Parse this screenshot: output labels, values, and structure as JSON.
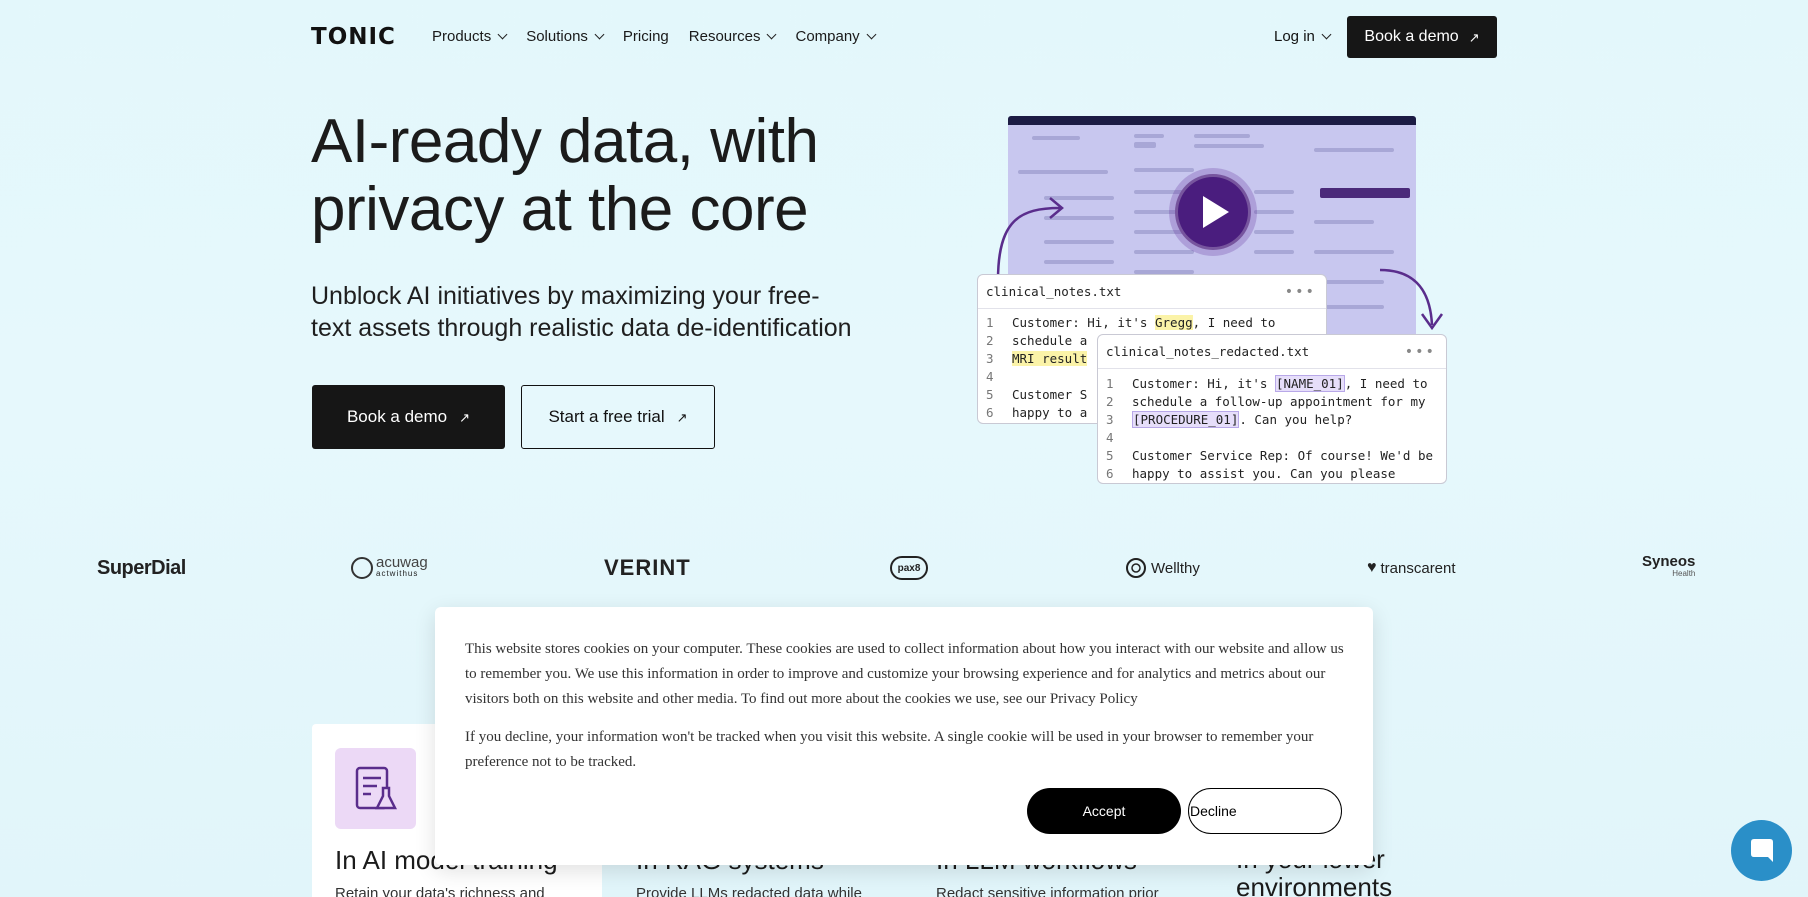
{
  "nav": {
    "logo": "TONIC",
    "links": [
      "Products",
      "Solutions",
      "Pricing",
      "Resources",
      "Company"
    ],
    "login": "Log in",
    "demo": "Book a demo"
  },
  "hero": {
    "title_line1": "AI-ready data, with",
    "title_line2": "privacy at the core",
    "subtitle_line1": "Unblock AI initiatives by maximizing your free-",
    "subtitle_line2": "text assets through realistic data de-identification",
    "primary_cta": "Book a demo",
    "secondary_cta": "Start a free trial"
  },
  "graphic": {
    "original": {
      "filename": "clinical_notes.txt",
      "lines": [
        {
          "n": "1",
          "pre": "Customer: Hi, it's ",
          "hl": "Gregg",
          "post": ", I need to"
        },
        {
          "n": "2",
          "pre": "schedule a",
          "hl": "",
          "post": ""
        },
        {
          "n": "3",
          "pre": "",
          "hl": "MRI result",
          "post": ""
        },
        {
          "n": "4",
          "pre": "",
          "hl": "",
          "post": ""
        },
        {
          "n": "5",
          "pre": "Customer S",
          "hl": "",
          "post": ""
        },
        {
          "n": "6",
          "pre": "happy to a",
          "hl": "",
          "post": ""
        }
      ]
    },
    "redacted": {
      "filename": "clinical_notes_redacted.txt",
      "lines": [
        {
          "n": "1",
          "pre": "Customer: Hi, it's ",
          "hl": "[NAME_01]",
          "post": ", I need to"
        },
        {
          "n": "2",
          "pre": "schedule a follow-up appointment for my",
          "hl": "",
          "post": ""
        },
        {
          "n": "3",
          "pre": "",
          "hl": "[PROCEDURE_01]",
          "post": ". Can you help?"
        },
        {
          "n": "4",
          "pre": "",
          "hl": "",
          "post": ""
        },
        {
          "n": "5",
          "pre": "Customer Service Rep: Of course! We'd be",
          "hl": "",
          "post": ""
        },
        {
          "n": "6",
          "pre": "happy to assist you. Can you please",
          "hl": "",
          "post": ""
        }
      ]
    }
  },
  "logos": [
    "SuperDial",
    "actwithus",
    "VERINT",
    "pax8",
    "Wellthy",
    "transcarent",
    "Syneos"
  ],
  "logo_subtext": {
    "acuwag": "acuwag",
    "syneos": "Health"
  },
  "cards": [
    {
      "title": "In AI model training",
      "desc": "Retain your data's richness and"
    },
    {
      "title": "In RAG systems",
      "desc": "Provide LLMs redacted data while"
    },
    {
      "title": "In LLM workflows",
      "desc": "Redact sensitive information prior"
    },
    {
      "title": "In your lower environments",
      "desc": ""
    }
  ],
  "cookie": {
    "text1": "This website stores cookies on your computer. These cookies are used to collect information about how you interact with our website and allow us to remember you. We use this information in order to improve and customize your browsing experience and for analytics and metrics about our visitors both on this website and other media. To find out more about the cookies we use, see our ",
    "privacy_link": "Privacy Policy",
    "text2": "If you decline, your information won't be tracked when you visit this website. A single cookie will be used in your browser to remember your preference not to be tracked.",
    "accept": "Accept",
    "decline": "Decline"
  },
  "colors": {
    "background": "#e3f7fb",
    "dark": "#161616",
    "accent_purple": "#4a1d7e",
    "chat_blue": "#2a8fc8"
  }
}
